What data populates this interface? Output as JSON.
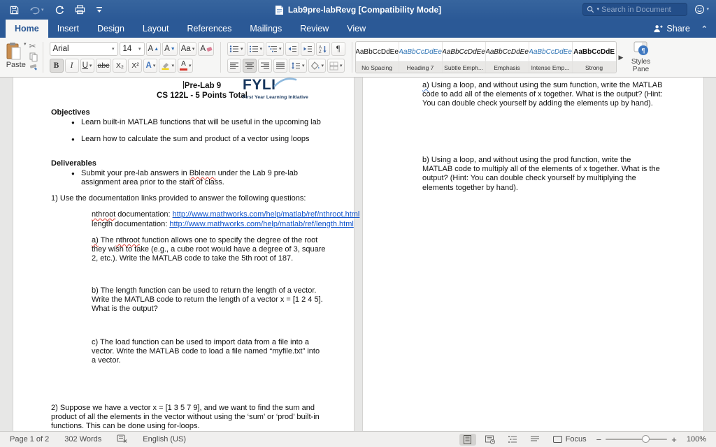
{
  "titlebar": {
    "title": "Lab9pre-labRevg [Compatibility Mode]",
    "search_placeholder": "Search in Document",
    "quick_access_icons": [
      "save-icon",
      "undo-icon",
      "redo-icon",
      "print-icon",
      "customize-toolbar-icon"
    ],
    "feedback_icon": "smiley-feedback-icon"
  },
  "tabbar": {
    "tabs": [
      "Home",
      "Insert",
      "Design",
      "Layout",
      "References",
      "Mailings",
      "Review",
      "View"
    ],
    "active_tab": "Home",
    "share_label": "Share"
  },
  "ribbon": {
    "paste_label": "Paste",
    "font": {
      "family": "Arial",
      "size": "14",
      "bold": "B",
      "italic": "I",
      "underline": "U",
      "strikethrough": "abc",
      "subscript": "X₂",
      "superscript": "X²",
      "grow_letter": "A",
      "shrink_letter": "A",
      "change_case": "Aa",
      "clear_letter": "A",
      "effects_letter": "A",
      "color_letter": "A"
    },
    "paragraph_mark": "¶",
    "styles": [
      {
        "preview": "AaBbCcDdEe",
        "label": "No Spacing"
      },
      {
        "preview": "AaBbCcDdEe",
        "label": "Heading 7"
      },
      {
        "preview": "AaBbCcDdEe",
        "label": "Subtle Emph..."
      },
      {
        "preview": "AaBbCcDdEe",
        "label": "Emphasis"
      },
      {
        "preview": "AaBbCcDdEe",
        "label": "Intense Emp..."
      },
      {
        "preview": "AaBbCcDdE",
        "label": "Strong"
      }
    ],
    "styles_pane_label": "Styles Pane"
  },
  "document": {
    "left_page": {
      "title": "Pre-Lab 9",
      "subtitle": "CS 122L - 5 Points Total",
      "logo": {
        "name": "FYLI",
        "tagline": "First Year Learning Initiative"
      },
      "objectives_heading": "Objectives",
      "objectives": [
        "Learn built-in MATLAB functions that will be useful in the upcoming lab",
        "Learn how to calculate the sum and product of a vector using loops"
      ],
      "deliverables_heading": "Deliverables",
      "deliverable": {
        "pre": "Submit your pre-lab answers in ",
        "word": "Bblearn",
        "post": " under the Lab 9 pre-lab assignment area prior to the start of class."
      },
      "q1_intro": "1) Use the documentation links provided to answer the following questions:",
      "link1": {
        "word": "nthroot",
        "mid": " documentation: ",
        "url": "http://www.mathworks.com/help/matlab/ref/nthroot.html"
      },
      "link2": {
        "word": "length",
        "mid": " documentation: ",
        "url": "http://www.mathworks.com/help/matlab/ref/length.html"
      },
      "q1a": {
        "marker": "a)",
        "pre": " The ",
        "word": "nthroot",
        "post": " function allows one to specify the degree of the root they wish to take (e.g., a cube root would have a degree of 3, square 2, etc.). Write the MATLAB code to take the 5th root of 187."
      },
      "q1b": "b) The length function can be used to return the length of a vector. Write the MATLAB code to return the length of a vector x = [1 2 4 5]. What is the output?",
      "q1c": "c) The load function can be used to import data from a file into a vector. Write the MATLAB code to load a file named “myfile.txt” into a vector.",
      "q2": "2) Suppose we have a vector x = [1 3 5 7 9], and we want to find the sum and product of all the elements in the vector without using the ‘sum’ or ‘prod’ built-in functions. This can be done using for-loops."
    },
    "right_page": {
      "qa": {
        "marker": "a)",
        "text": " Using a loop, and without using the sum function, write the MATLAB code to add all of the elements of x together. What is the output? (Hint: You can double check yourself by adding the elements up by hand)."
      },
      "qb": "b) Using a loop, and without using the prod function, write the MATLAB code to multiply all of the elements of x together. What is the output? (Hint: You can double check yourself by multiplying the elements together by hand)."
    }
  },
  "statusbar": {
    "page_info": "Page 1 of 2",
    "word_count": "302 Words",
    "language": "English (US)",
    "focus_label": "Focus",
    "zoom_level": "100%"
  }
}
